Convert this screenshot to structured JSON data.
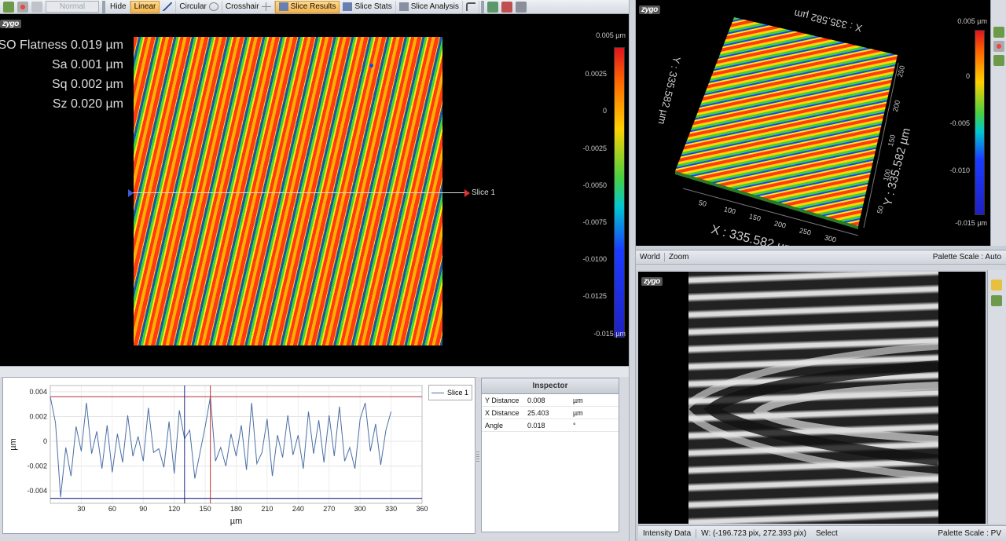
{
  "toolbar": {
    "quality_select": "Normal",
    "buttons": [
      "Hide",
      "Linear",
      "Circular",
      "Crosshair",
      "Slice Results",
      "Slice Stats",
      "Slice Analysis"
    ],
    "active_button": "Linear",
    "active_button_2": "Slice Results"
  },
  "main_view": {
    "logo": "zygo",
    "stats": [
      "ISO Flatness 0.019 µm",
      "Sa 0.001 µm",
      "Sq 0.002 µm",
      "Sz 0.020 µm"
    ],
    "slice_label": "Slice 1",
    "colorbar_ticks": [
      "0.005 µm",
      "0.0025",
      "0",
      "-0.0025",
      "-0.0050",
      "-0.0075",
      "-0.0100",
      "-0.0125",
      "-0.015 µm"
    ]
  },
  "view3d": {
    "logo": "zygo",
    "x_label": "X : 335.582 µm",
    "y_label": "Y : 335.582 µm",
    "x_ticks": [
      "50",
      "100",
      "150",
      "200",
      "250",
      "300"
    ],
    "y_ticks": [
      "50",
      "100",
      "150",
      "200",
      "250"
    ],
    "colorbar_ticks": [
      "0.005 µm",
      "0",
      "-0.005",
      "-0.010",
      "-0.015 µm"
    ],
    "status_left_1": "World",
    "status_left_2": "Zoom",
    "status_right": "Palette Scale : Auto"
  },
  "intensity": {
    "logo": "zygo",
    "status_left": "Intensity Data",
    "status_coord": "W: (-196.723 pix, 272.393 pix)",
    "status_mode": "Select",
    "status_right": "Palette Scale : PV"
  },
  "inspector": {
    "title": "Inspector",
    "rows": [
      {
        "label": "Y Distance",
        "value": "0.008",
        "unit": "µm"
      },
      {
        "label": "X Distance",
        "value": "25.403",
        "unit": "µm"
      },
      {
        "label": "Angle",
        "value": "0.018",
        "unit": "°"
      }
    ]
  },
  "chart_data": {
    "type": "line",
    "xlabel": "µm",
    "ylabel": "µm",
    "xlim": [
      0,
      360
    ],
    "ylim": [
      -0.005,
      0.0045
    ],
    "x_ticks": [
      30,
      60,
      90,
      120,
      150,
      180,
      210,
      240,
      270,
      300,
      330,
      360
    ],
    "y_ticks": [
      "0.004",
      "0.002",
      "0",
      "-0.002",
      "-0.004"
    ],
    "legend": "top-right",
    "grid": true,
    "cursor_vertical_1": 130,
    "cursor_vertical_2": 155,
    "cursor_horizontal_top": 0.0036,
    "cursor_horizontal_bottom": -0.0046,
    "series": [
      {
        "name": "Slice 1",
        "color": "#4a6fa5",
        "x": [
          0,
          5,
          10,
          15,
          20,
          25,
          30,
          35,
          40,
          45,
          50,
          55,
          60,
          65,
          70,
          75,
          80,
          85,
          90,
          95,
          100,
          105,
          110,
          115,
          120,
          125,
          130,
          135,
          140,
          145,
          150,
          155,
          160,
          165,
          170,
          175,
          180,
          185,
          190,
          195,
          200,
          205,
          210,
          215,
          220,
          225,
          230,
          235,
          240,
          245,
          250,
          255,
          260,
          265,
          270,
          275,
          280,
          285,
          290,
          295,
          300,
          305,
          310,
          315,
          320,
          325,
          330
        ],
        "y": [
          0.0036,
          0.0015,
          -0.0045,
          -0.0005,
          -0.0028,
          0.0012,
          -0.0008,
          0.0031,
          -0.001,
          0.0008,
          -0.0022,
          0.0013,
          -0.0025,
          0.0006,
          -0.0017,
          0.0021,
          -0.0012,
          0.0004,
          -0.0016,
          0.0027,
          -0.0009,
          -0.0006,
          -0.0021,
          0.0016,
          -0.0026,
          0.0025,
          0.0002,
          0.0009,
          -0.003,
          -0.0009,
          0.0012,
          0.0036,
          -0.0016,
          -0.0005,
          -0.002,
          0.0006,
          -0.0012,
          0.0013,
          -0.0023,
          0.0031,
          -0.0018,
          -0.0009,
          0.0018,
          -0.0028,
          0.0005,
          -0.0013,
          0.0021,
          -0.0011,
          0.0005,
          -0.0022,
          0.0024,
          -0.001,
          0.0017,
          -0.0017,
          0.0021,
          -0.0012,
          0.0028,
          -0.0016,
          -0.0005,
          -0.0022,
          0.0018,
          0.0031,
          -0.0008,
          0.0014,
          -0.0019,
          0.0009,
          0.0024
        ]
      }
    ]
  }
}
